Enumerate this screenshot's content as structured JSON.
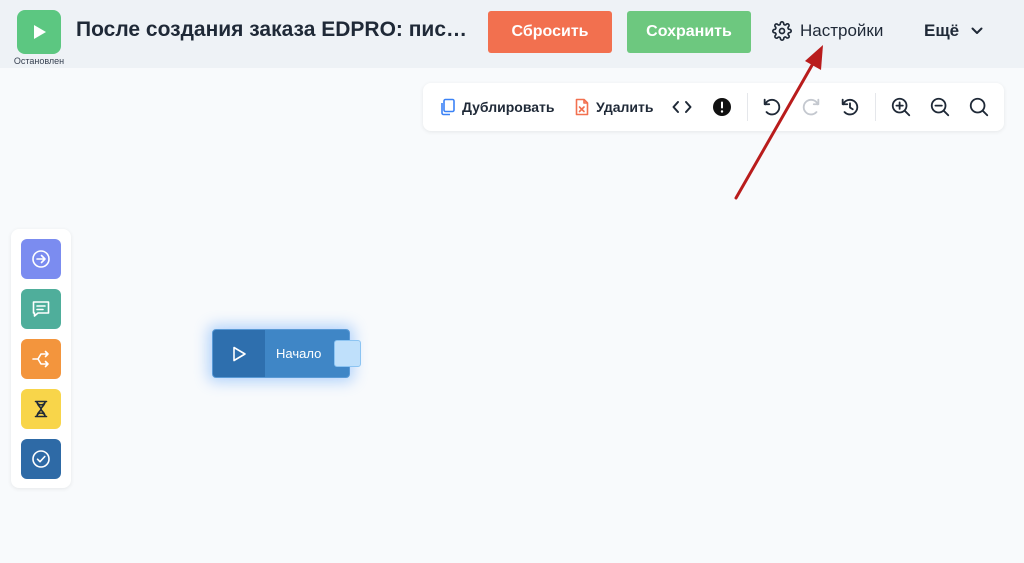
{
  "header": {
    "status_label": "Остановлен",
    "title": "После создания заказа EDPRO: пись...",
    "reset_label": "Сбросить",
    "save_label": "Сохранить",
    "settings_label": "Настройки",
    "more_label": "Ещё"
  },
  "toolbar": {
    "duplicate_label": "Дублировать",
    "delete_label": "Удалить"
  },
  "palette": {
    "items": [
      "arrow-right-circle-icon",
      "chat-icon",
      "branch-icon",
      "hourglass-icon",
      "check-circle-icon"
    ]
  },
  "node": {
    "label": "Начало"
  },
  "colors": {
    "status": "#5cc781",
    "reset": "#f2704f",
    "save": "#6dc87f",
    "node": "#3f86c6",
    "annotation_arrow": "#b91c1c"
  }
}
